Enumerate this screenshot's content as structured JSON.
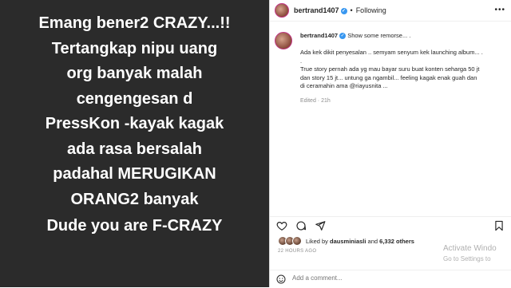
{
  "story": {
    "lines": [
      "Emang bener2 CRAZY...!!",
      "Tertangkap nipu uang",
      "org banyak malah",
      "cengengesan  d",
      "PressKon -kayak kagak",
      "ada rasa bersalah",
      "padahal MERUGIKAN",
      "ORANG2 banyak"
    ],
    "dude": "Dude you are F-CRAZY"
  },
  "header": {
    "username": "bertrand1407",
    "separator": "•",
    "follow_status": "Following",
    "more_icon": "more-horizontal-icon"
  },
  "comment": {
    "username": "bertrand1407",
    "lines": [
      "Show some remorse... .",
      "",
      "Ada kek dikit penyesalan .. semyam senyum kek launching album... .",
      ".",
      "True story pernah ada yg mau bayar suru buat konten seharga 50 jt",
      "dan story 15 jt... untung ga ngambil... feeling kagak enak guah dan",
      "di ceramahin ama @riayusnita ..."
    ],
    "edited": "Edited · 21h"
  },
  "likes": {
    "prefix": "Liked by ",
    "user": "dausminiasli",
    "mid": " and ",
    "count": "6,332 others"
  },
  "time": "22 HOURS AGO",
  "add_comment": {
    "placeholder": "Add a comment..."
  },
  "watermark": {
    "line1": "Activate Windo",
    "line2": "Go to Settings to"
  },
  "colors": {
    "left_bg": "#2b2b2b",
    "verified": "#3897f0"
  }
}
